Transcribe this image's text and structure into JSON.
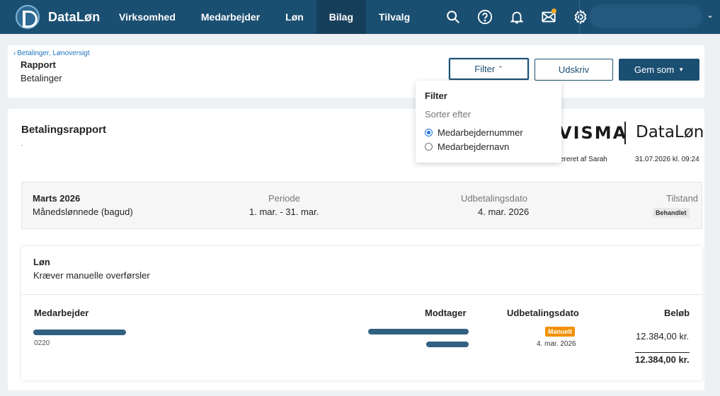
{
  "app": {
    "name": "DataLøn"
  },
  "nav": {
    "items": [
      {
        "label": "Virksomhed",
        "active": false
      },
      {
        "label": "Medarbejder",
        "active": false
      },
      {
        "label": "Løn",
        "active": false
      },
      {
        "label": "Bilag",
        "active": true
      },
      {
        "label": "Tilvalg",
        "active": false
      }
    ],
    "icons": [
      "search-icon",
      "help-icon",
      "bell-icon",
      "mail-icon",
      "gear-icon"
    ],
    "accent": "#1b4f72",
    "notification_color": "#f5a623"
  },
  "header": {
    "breadcrumb": "Betalinger, Lønoversigt",
    "title": "Rapport",
    "subtitle": "Betalinger",
    "filter_label": "Filter",
    "print_label": "Udskriv",
    "save_label": "Gem som"
  },
  "filter_popover": {
    "title": "Filter",
    "sort_label": "Sorter efter",
    "options": [
      {
        "label": "Medarbejdernummer",
        "selected": true
      },
      {
        "label": "Medarbejdernavn",
        "selected": false
      }
    ]
  },
  "report": {
    "title": "Betalingsrapport",
    "dot": ".",
    "brand_left": "VISMA",
    "brand_right": "DataLøn",
    "created_by": "ereret af Sarah",
    "created_at": "31.07.2026 kl. 09:24",
    "period": {
      "name": "Marts 2026",
      "type": "Månedslønnede (bagud)",
      "period_header": "Periode",
      "period_value": "1. mar. - 31. mar.",
      "payout_header": "Udbetalingsdato",
      "payout_value": "4. mar. 2026",
      "state_header": "Tilstand",
      "state_value": "Behandlet"
    },
    "payments": {
      "title": "Løn",
      "subtitle": "Kræver manuelle overførsler",
      "headers": {
        "employee": "Medarbejder",
        "receiver": "Modtager",
        "payout_date": "Udbetalingsdato",
        "amount": "Beløb"
      },
      "rows": [
        {
          "employee_no": "0220",
          "method": "Manuelt",
          "payout_date": "4. mar. 2026",
          "amount": "12.384,00 kr."
        }
      ],
      "total": "12.384,00 kr."
    }
  }
}
